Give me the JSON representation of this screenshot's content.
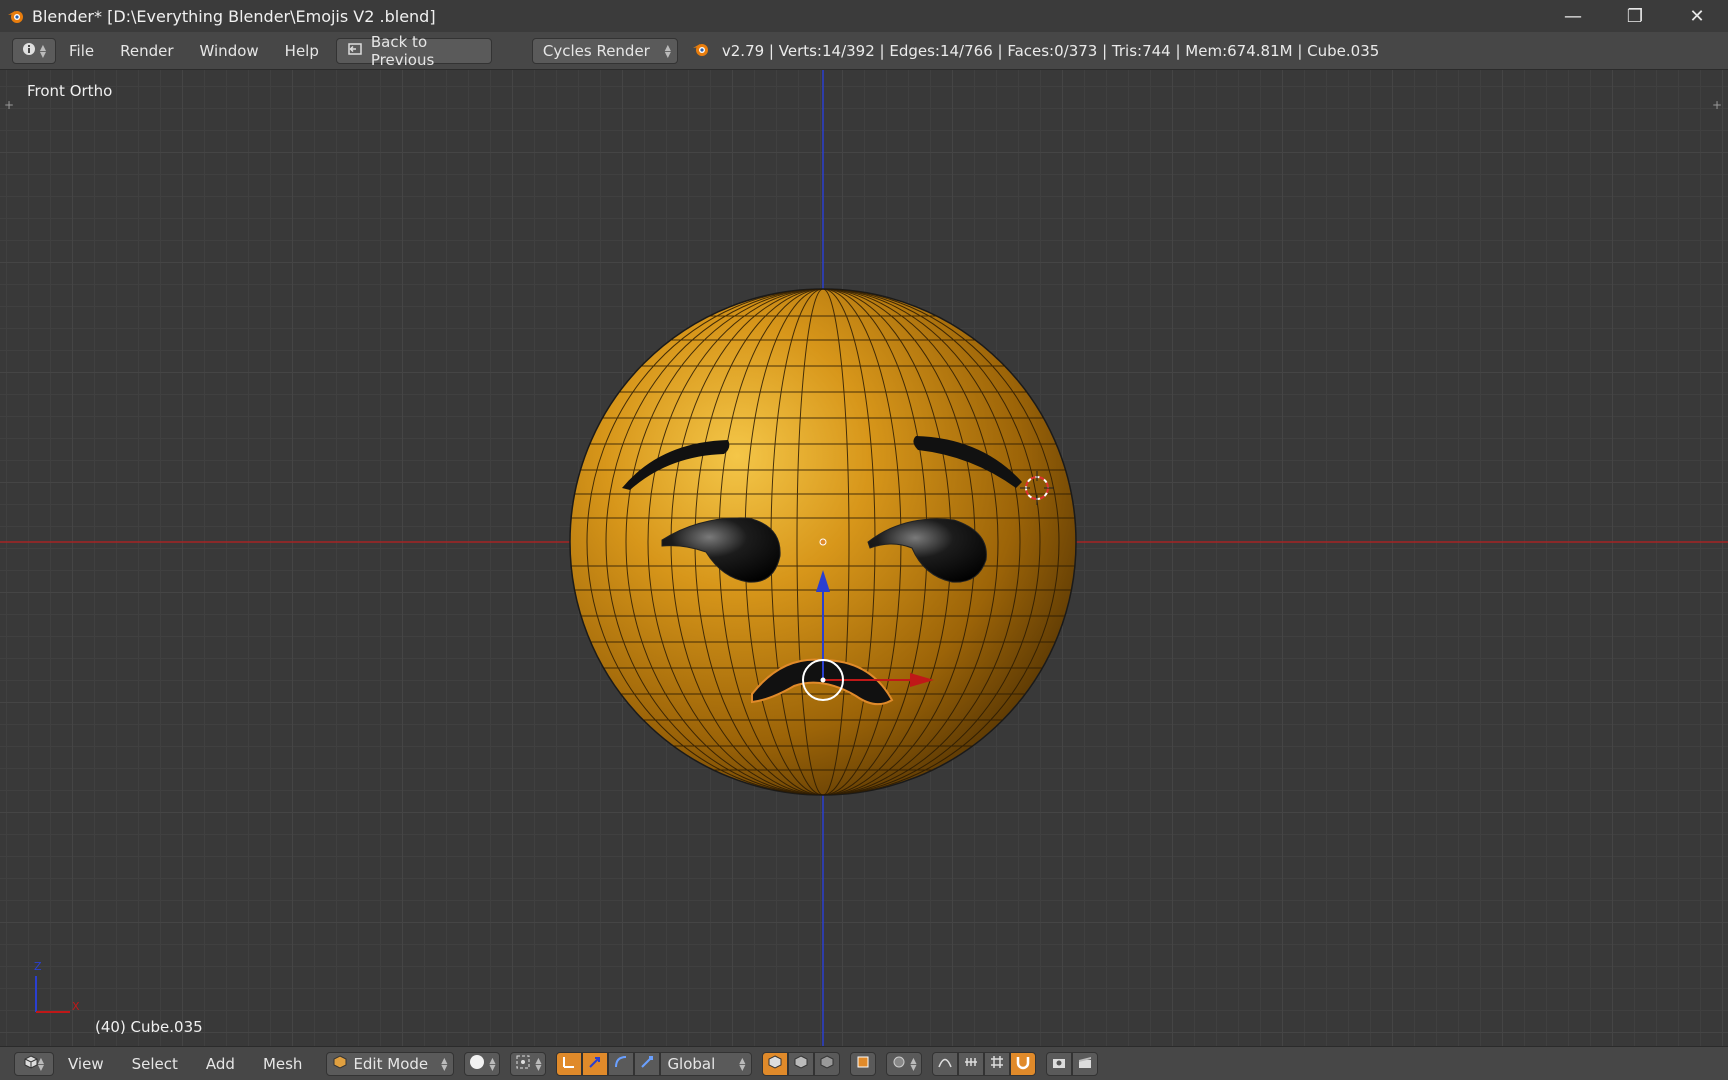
{
  "window": {
    "title": "Blender* [D:\\Everything Blender\\Emojis V2 .blend]",
    "minimize_glyph": "—",
    "restore_glyph": "❐",
    "close_glyph": "✕"
  },
  "info_header": {
    "menus": [
      "File",
      "Render",
      "Window",
      "Help"
    ],
    "back_button": "Back to Previous",
    "render_engine": "Cycles Render",
    "stats": "v2.79 | Verts:14/392 | Edges:14/766 | Faces:0/373 | Tris:744 | Mem:674.81M | Cube.035"
  },
  "viewport": {
    "view_label": "Front Ortho",
    "object_label": "(40) Cube.035",
    "axis_z": "Z",
    "axis_x": "X",
    "colors": {
      "sphere": "#c88a12",
      "x_axis": "#b02020",
      "z_axis": "#2a3fd0",
      "selection": "#e08a2a"
    }
  },
  "bottom_header": {
    "menus": [
      "View",
      "Select",
      "Add",
      "Mesh"
    ],
    "mode": "Edit Mode",
    "orientation": "Global"
  },
  "icons": [
    "blender-logo",
    "info-icon",
    "back-icon",
    "cube-icon",
    "sphere-shading-icon",
    "pivot-icon",
    "manipulator-icons",
    "proportional-icon",
    "snap-icon",
    "render-icon"
  ]
}
